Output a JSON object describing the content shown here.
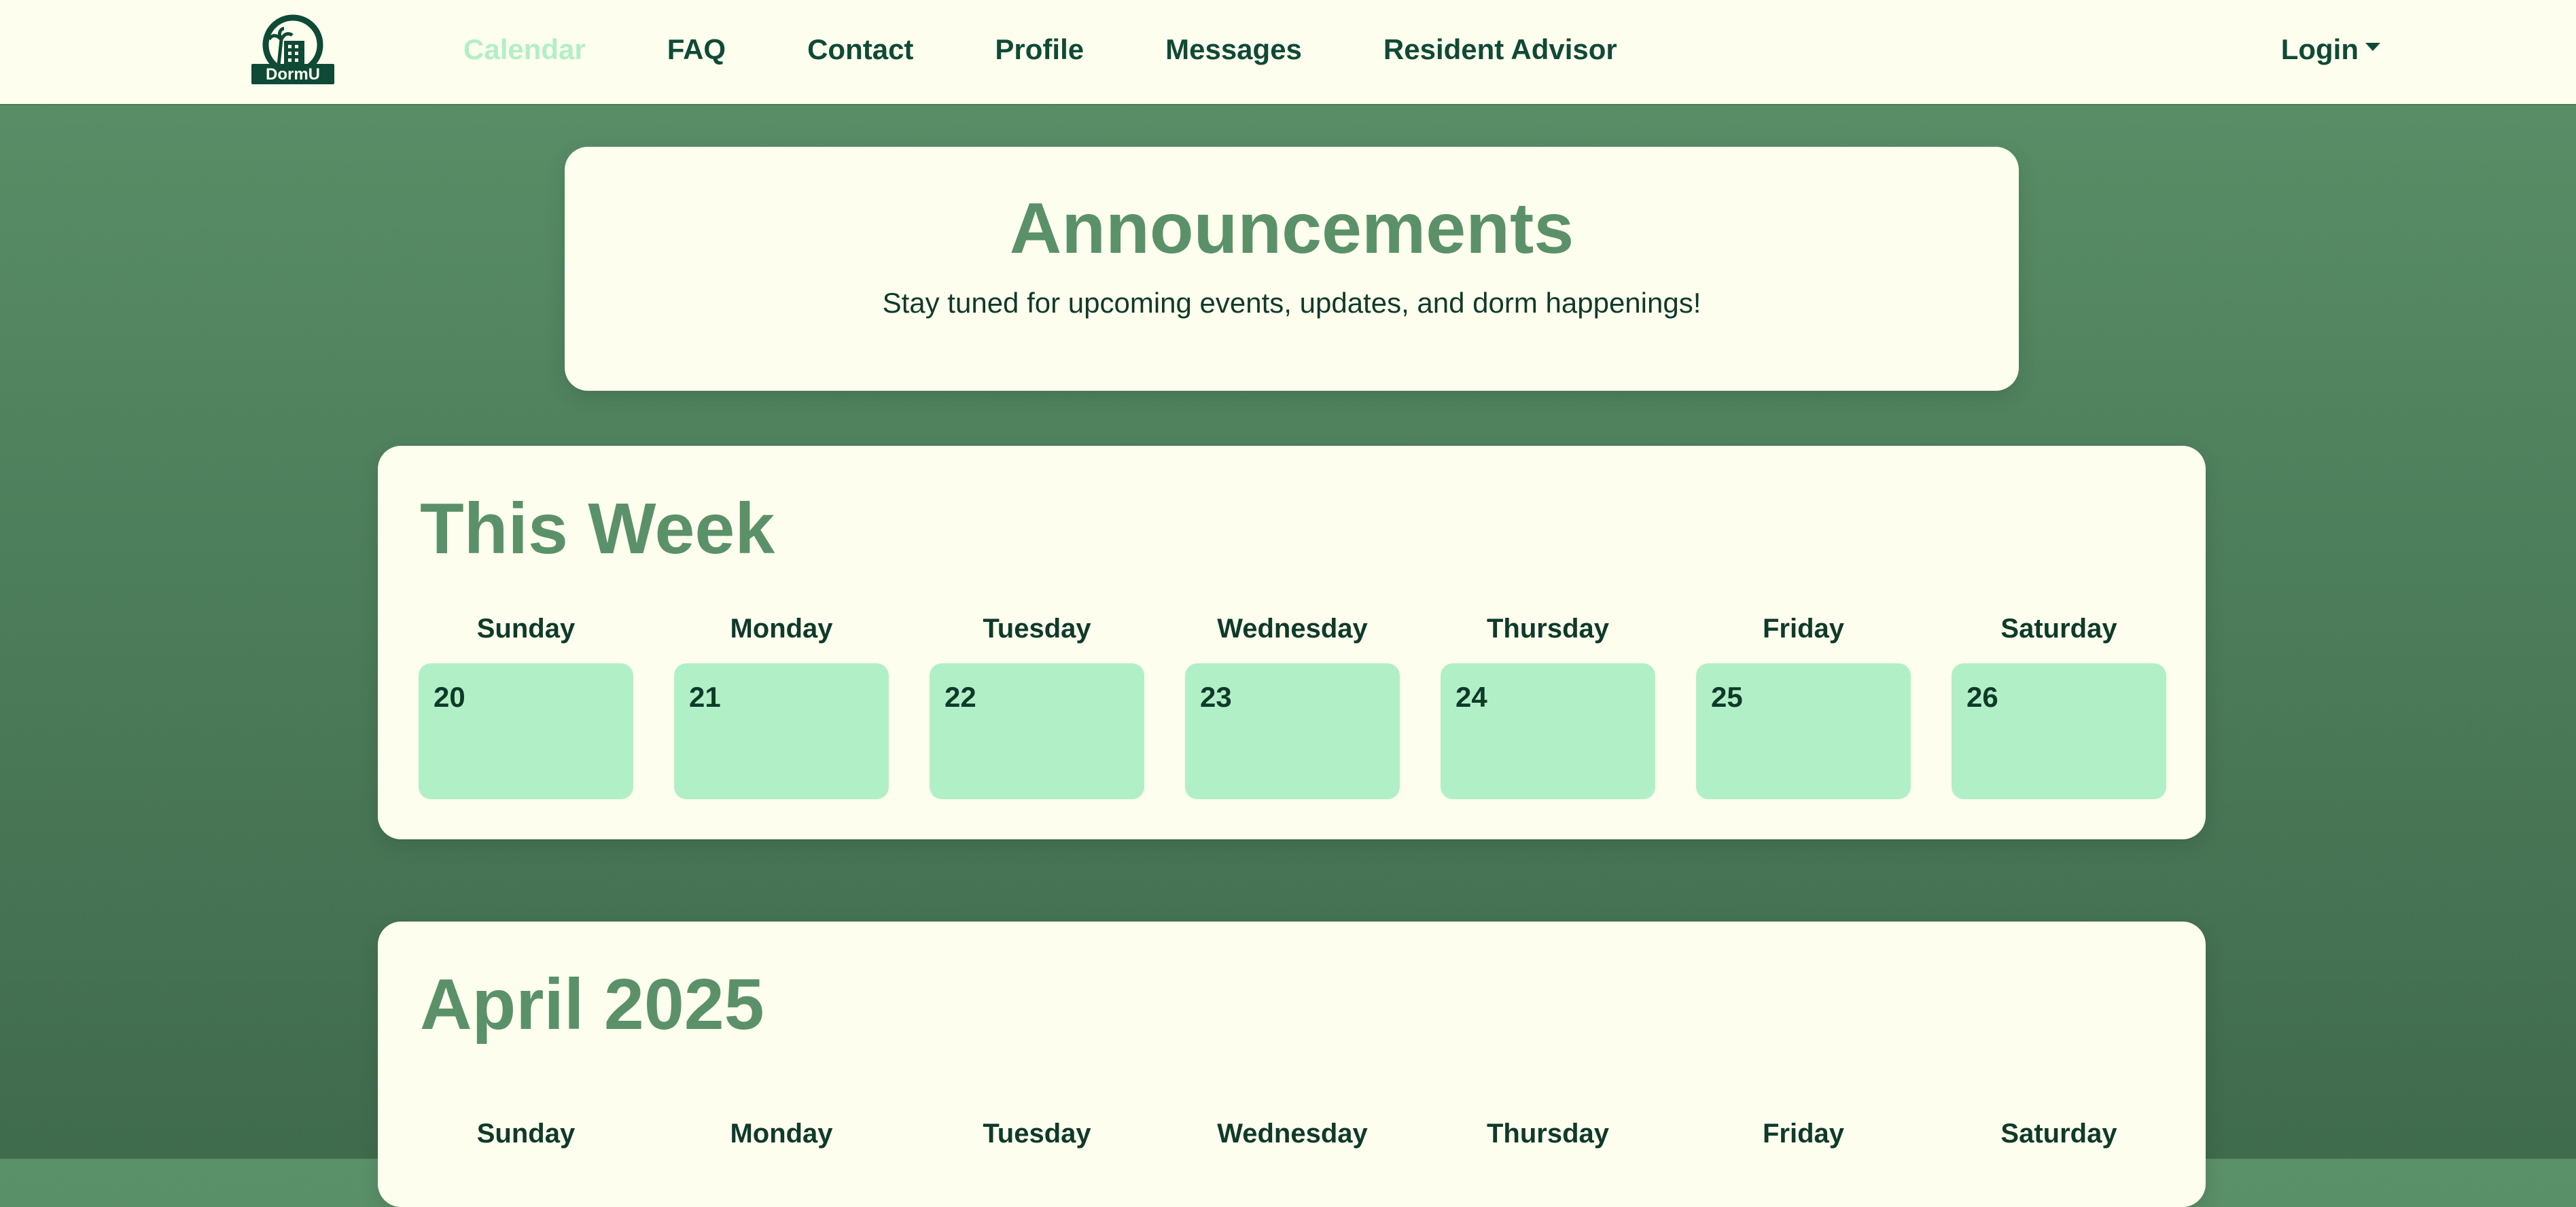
{
  "navbar": {
    "logo_text": "DormU",
    "links": [
      "Calendar",
      "FAQ",
      "Contact",
      "Profile",
      "Messages",
      "Resident Advisor"
    ],
    "active_link": "Calendar",
    "login_label": "Login"
  },
  "announcements": {
    "title": "Announcements",
    "subtitle": "Stay tuned for upcoming events, updates, and dorm happenings!"
  },
  "week": {
    "title": "This Week",
    "days": [
      {
        "name": "Sunday",
        "date": "20"
      },
      {
        "name": "Monday",
        "date": "21"
      },
      {
        "name": "Tuesday",
        "date": "22"
      },
      {
        "name": "Wednesday",
        "date": "23"
      },
      {
        "name": "Thursday",
        "date": "24"
      },
      {
        "name": "Friday",
        "date": "25"
      },
      {
        "name": "Saturday",
        "date": "26"
      }
    ]
  },
  "month": {
    "title": "April 2025",
    "day_names": [
      "Sunday",
      "Monday",
      "Tuesday",
      "Wednesday",
      "Thursday",
      "Friday",
      "Saturday"
    ]
  },
  "colors": {
    "accent": "#5b9169",
    "nav_text": "#0f4a36",
    "active_link": "#b2efc6",
    "day_cell": "#b1f0c6",
    "card_bg": "#fefeee"
  }
}
